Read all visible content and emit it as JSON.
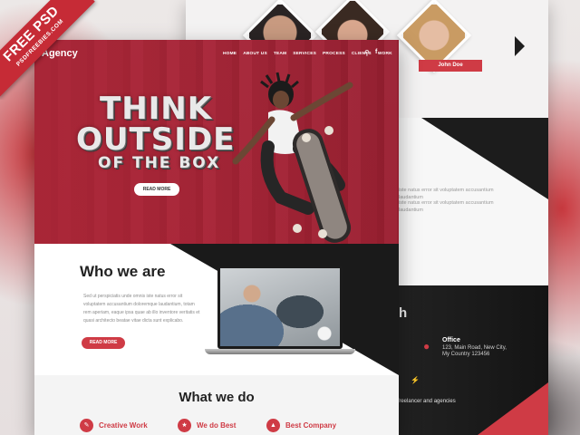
{
  "ribbon": {
    "main": "FREE PSD",
    "sub": "PSDFREEBIES.COM"
  },
  "front": {
    "logo": "Agency",
    "nav": [
      "HOME",
      "ABOUT US",
      "TEAM",
      "SERVICES",
      "PROCESS",
      "CLIENTS",
      "WORK"
    ],
    "icons": {
      "search": "search-icon",
      "facebook": "facebook-icon"
    },
    "hero": {
      "line1": "THINK",
      "line2": "OUTSIDE",
      "line3": "OF THE BOX",
      "button": "READ MORE"
    },
    "about": {
      "title": "Who we are",
      "text": "Sed ut perspiciatis unde omnis iste natus error sit voluptatem accusantium doloremque laudantium, totam rem aperiam, eaque ipsa quae ab illo inventore veritatis et quasi architecto beatae vitae dicta sunt explicabo.",
      "button": "READ MORE"
    },
    "services": {
      "title": "What we do",
      "items": [
        {
          "label": "Creative Work",
          "icon": "creative-icon"
        },
        {
          "label": "We do Best",
          "icon": "thumb-icon"
        },
        {
          "label": "Best Company",
          "icon": "chart-icon"
        }
      ]
    }
  },
  "back": {
    "team_member": "John Doe",
    "lorem1": "iste natus error sit voluptatem accusantium laudantium",
    "lorem2": "iste natus error sit voluptatem accusantium laudantium",
    "contact_heading": "th",
    "office": {
      "title": "Office",
      "line1": "123, Main Road, New City,",
      "line2": "My Country 123456"
    },
    "freelancer": "r freelancer and agencies"
  },
  "colors": {
    "accent": "#cf3b45",
    "dark": "#1a1a1a"
  }
}
